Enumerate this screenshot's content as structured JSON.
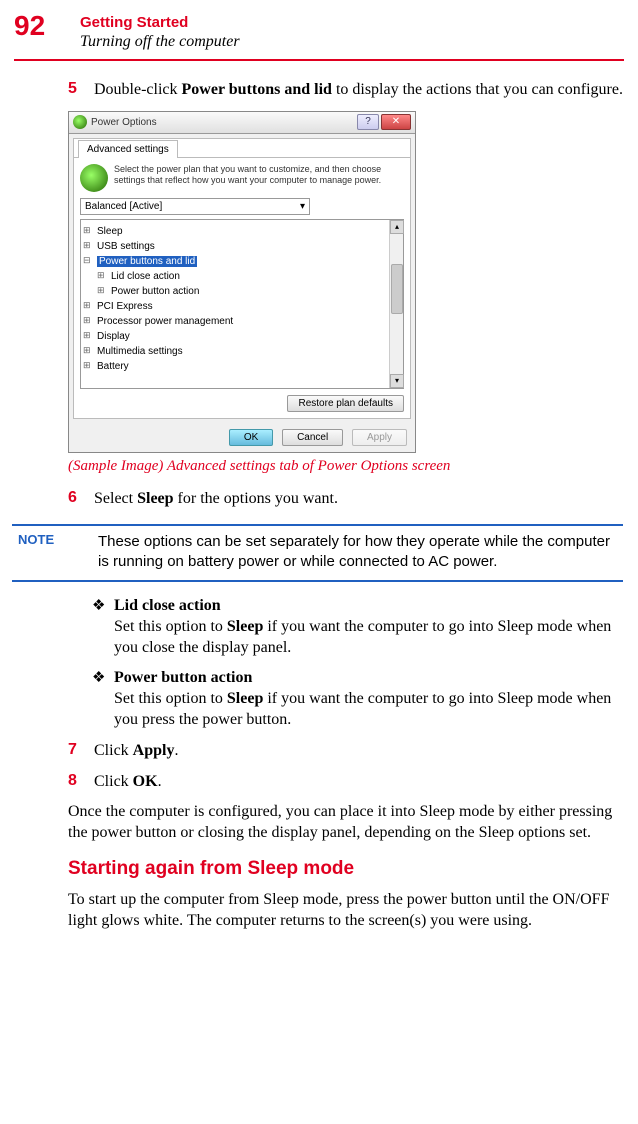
{
  "page_number": "92",
  "chapter_title": "Getting Started",
  "section_subtitle": "Turning off the computer",
  "step5": {
    "num": "5",
    "prefix": "Double-click ",
    "bold": "Power buttons and lid",
    "suffix": " to display the actions that you can configure."
  },
  "dialog": {
    "title": "Power Options",
    "help": "?",
    "close": "✕",
    "tab": "Advanced settings",
    "intro": "Select the power plan that you want to customize, and then choose settings that reflect how you want your computer to manage power.",
    "plan": "Balanced [Active]",
    "tree": {
      "sleep": "Sleep",
      "usb": "USB settings",
      "pbl": "Power buttons and lid",
      "lid": "Lid close action",
      "pba": "Power button action",
      "pci": "PCI Express",
      "ppm": "Processor power management",
      "display": "Display",
      "mm": "Multimedia settings",
      "battery": "Battery"
    },
    "restore": "Restore plan defaults",
    "ok": "OK",
    "cancel": "Cancel",
    "apply": "Apply"
  },
  "caption": "(Sample Image) Advanced settings tab of Power Options screen",
  "step6": {
    "num": "6",
    "prefix": "Select ",
    "bold": "Sleep",
    "suffix": " for the options you want."
  },
  "note": {
    "label": "NOTE",
    "text": "These options can be set separately for how they operate while the computer is running on battery power or while connected to AC power."
  },
  "bullet1": {
    "head": "Lid close action",
    "prefix": "Set this option to ",
    "bold": "Sleep",
    "suffix": " if you want the computer to go into Sleep mode when you close the display panel."
  },
  "bullet2": {
    "head": "Power button action",
    "prefix": "Set this option to ",
    "bold": "Sleep",
    "suffix": " if you want the computer to go into Sleep mode when you press the power button."
  },
  "step7": {
    "num": "7",
    "prefix": "Click ",
    "bold": "Apply",
    "suffix": "."
  },
  "step8": {
    "num": "8",
    "prefix": "Click ",
    "bold": "OK",
    "suffix": "."
  },
  "para_config": "Once the computer is configured, you can place it into Sleep mode by either pressing the power button or closing the display panel, depending on the Sleep options set.",
  "h3_start": "Starting again from Sleep mode",
  "para_start": "To start up the computer from Sleep mode, press the power button until the ON/OFF light glows white. The computer returns to the screen(s) you were using."
}
